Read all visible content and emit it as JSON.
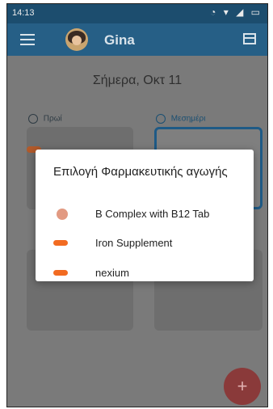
{
  "status_bar": {
    "time": "14:13",
    "icons": "◔ ▾ ◢ ▭"
  },
  "app_bar": {
    "user_name": "Gina"
  },
  "main": {
    "date_title": "Σήμερα, Οκτ 11",
    "sections": [
      {
        "label": "Πρωί",
        "icon": "sunrise-icon"
      },
      {
        "label": "Μεσημέρι",
        "icon": "sun-icon"
      }
    ],
    "fab_label": "+"
  },
  "dialog": {
    "title": "Επιλογή Φαρμακευτικής αγωγής",
    "options": [
      {
        "label": "B Complex with B12 Tab",
        "icon": "pill-round-icon",
        "color": "#e29a82"
      },
      {
        "label": "Iron Supplement",
        "icon": "pill-capsule-icon",
        "color": "#f26b21"
      },
      {
        "label": "nexium",
        "icon": "pill-capsule-icon",
        "color": "#f26b21"
      }
    ]
  }
}
